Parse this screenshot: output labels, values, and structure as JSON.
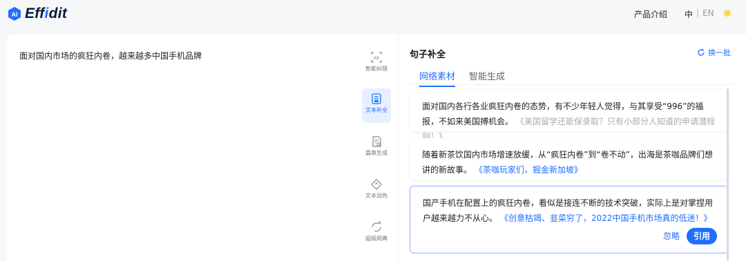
{
  "header": {
    "logo_ai": "AI",
    "logo_pre": "Eff",
    "logo_hl": "i",
    "logo_post": "dit",
    "product_intro": "产品介绍",
    "lang_zh": "中",
    "lang_sep": "|",
    "lang_en": "EN"
  },
  "editor": {
    "text": "面对国内市场的疯狂内卷，越来越多中国手机品牌"
  },
  "tools": [
    {
      "label": "智能纠错",
      "icon": "ai-proofread-icon"
    },
    {
      "label": "文本补全",
      "icon": "text-complete-icon"
    },
    {
      "label": "篇章生成",
      "icon": "article-generate-icon"
    },
    {
      "label": "文本润色",
      "icon": "text-polish-icon"
    },
    {
      "label": "超级网典",
      "icon": "super-dictionary-icon"
    }
  ],
  "panel": {
    "title": "句子补全",
    "refresh": "换一批",
    "tabs": [
      "网络素材",
      "智能生成"
    ],
    "results": [
      {
        "text": "面对国内各行各业疯狂内卷的态势，有不少年轻人觉得，与其享受“996”的福报，不如来美国搏机会。",
        "source": "《美国留学还能保录取？只有小部分人知道的申请潜规则！》"
      },
      {
        "text": "随着新茶饮国内市场增速放缓，从“疯狂内卷”到“卷不动”，出海是茶咖品牌们想讲的新故事。",
        "source": "《茶咖玩家们，掘金新加坡》"
      },
      {
        "text": "国产手机在配置上的疯狂内卷，看似是接连不断的技术突破，实际上是对掌捏用户越来越力不从心。",
        "source": "《创意枯竭、韭菜穷了，2022中国手机市场真的低迷！》"
      }
    ],
    "ignore": "忽略",
    "cite": "引用"
  },
  "colors": {
    "accent": "#1e6fff",
    "active_tool_bg": "#e8f0ff",
    "selected_border": "#8db2ff"
  }
}
